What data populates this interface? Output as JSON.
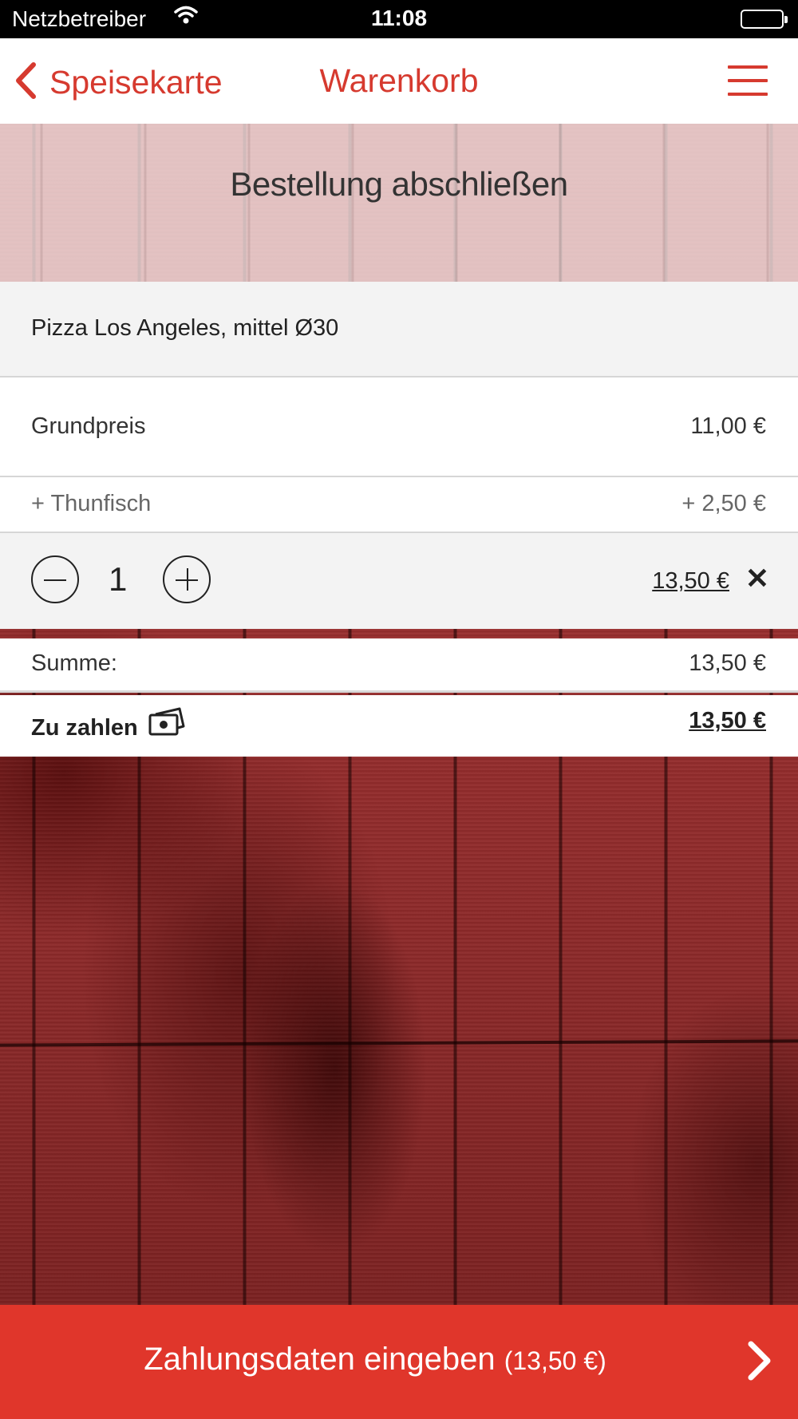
{
  "status_bar": {
    "carrier": "Netzbetreiber",
    "time": "11:08"
  },
  "nav": {
    "back_label": "Speisekarte",
    "title": "Warenkorb"
  },
  "banner": {
    "heading": "Bestellung abschließen"
  },
  "cart_item": {
    "name": "Pizza Los Angeles, mittel Ø30",
    "base_price_label": "Grundpreis",
    "base_price": "11,00 €",
    "extras": [
      {
        "label": "+ Thunfisch",
        "price": "+ 2,50 €"
      }
    ],
    "quantity": "1",
    "line_total": "13,50 €"
  },
  "totals": {
    "sum_label": "Summe:",
    "sum_value": "13,50 €",
    "pay_label": "Zu zahlen",
    "pay_value": "13,50 €"
  },
  "cta": {
    "label": "Zahlungsdaten eingeben",
    "amount": "(13,50 €)"
  },
  "colors": {
    "accent": "#d63a2f",
    "cta_background": "#e0362b"
  }
}
